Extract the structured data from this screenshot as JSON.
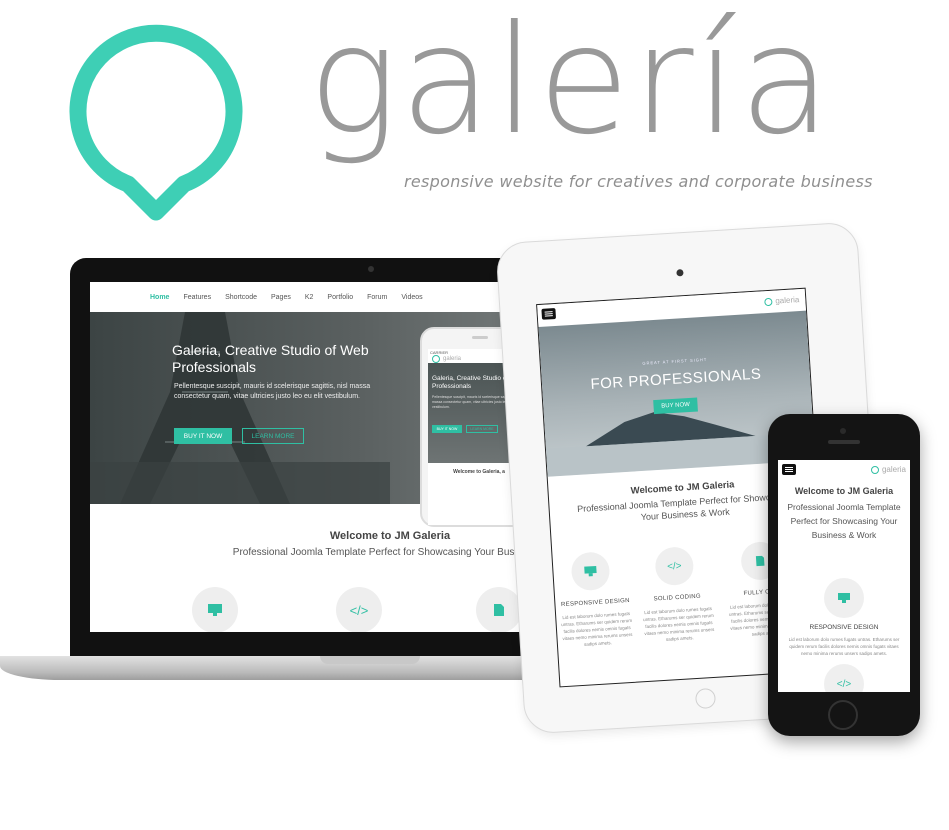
{
  "brand": {
    "wordmark": "galería",
    "tagline": "responsive website for creatives and corporate business",
    "accent_color": "#3ecfb5",
    "logo_icon": "map-pin-icon"
  },
  "laptop": {
    "nav": [
      "Home",
      "Features",
      "Shortcode",
      "Pages",
      "K2",
      "Portfolio",
      "Forum",
      "Videos"
    ],
    "hero_title": "Galeria, Creative Studio of Web Professionals",
    "hero_text": "Pellentesque suscipit, mauris id scelerisque sagittis, nisl massa consectetur quam, vitae ultricies justo leo eu elit vestibulum.",
    "buy_label": "BUY IT NOW",
    "learn_label": "LEARN MORE",
    "welcome_title": "Welcome to JM Galeria",
    "welcome_sub": "Professional Joomla Template Perfect for Showcasing Your Business &",
    "mini_phone": {
      "carrier": "CARRIER",
      "logo": "galeria",
      "hero_title": "Galeria, Creative Studio of Web Professionals",
      "hero_text": "Pellentesque suscipit, mauris id scelerisque sagittis, nisl massa consectetur quam, vitae ultricies justo leo eu elit vestibulum.",
      "buy_label": "BUY IT NOW",
      "learn_label": "LEARN MORE",
      "welcome": "Welcome to Galeria, a"
    }
  },
  "tablet": {
    "logo": "galeria",
    "hero_kicker": "GREAT AT FIRST SIGHT",
    "hero_title": "FOR PROFESSIONALS",
    "buy_label": "BUY NOW",
    "welcome_title": "Welcome to JM Galeria",
    "welcome_sub": "Professional Joomla Template Perfect for Showcasing Your Business & Work",
    "features": [
      {
        "title": "RESPONSIVE DESIGN",
        "icon": "monitor-icon"
      },
      {
        "title": "SOLID CODING",
        "icon": "code-icon"
      },
      {
        "title": "FULLY CUST",
        "icon": "document-icon"
      }
    ],
    "lorem": "Lid est laborum dolo rumes fugats untras. Etharums ser quidem rerum facilis dolores nemis omnis fugats vitaes nemo minima rerums unsers sadips amets."
  },
  "phone": {
    "logo": "galeria",
    "welcome_title": "Welcome to JM Galeria",
    "welcome_sub": "Professional Joomla Template Perfect for Showcasing Your Business & Work",
    "feature_title": "RESPONSIVE DESIGN",
    "lorem": "Lid est laborum dolo rumes fugats untras. Etharums ser quidem rerum facilis dolores nemis omnis fugats vitaes nemo minima rerums unsers sadips amets."
  }
}
